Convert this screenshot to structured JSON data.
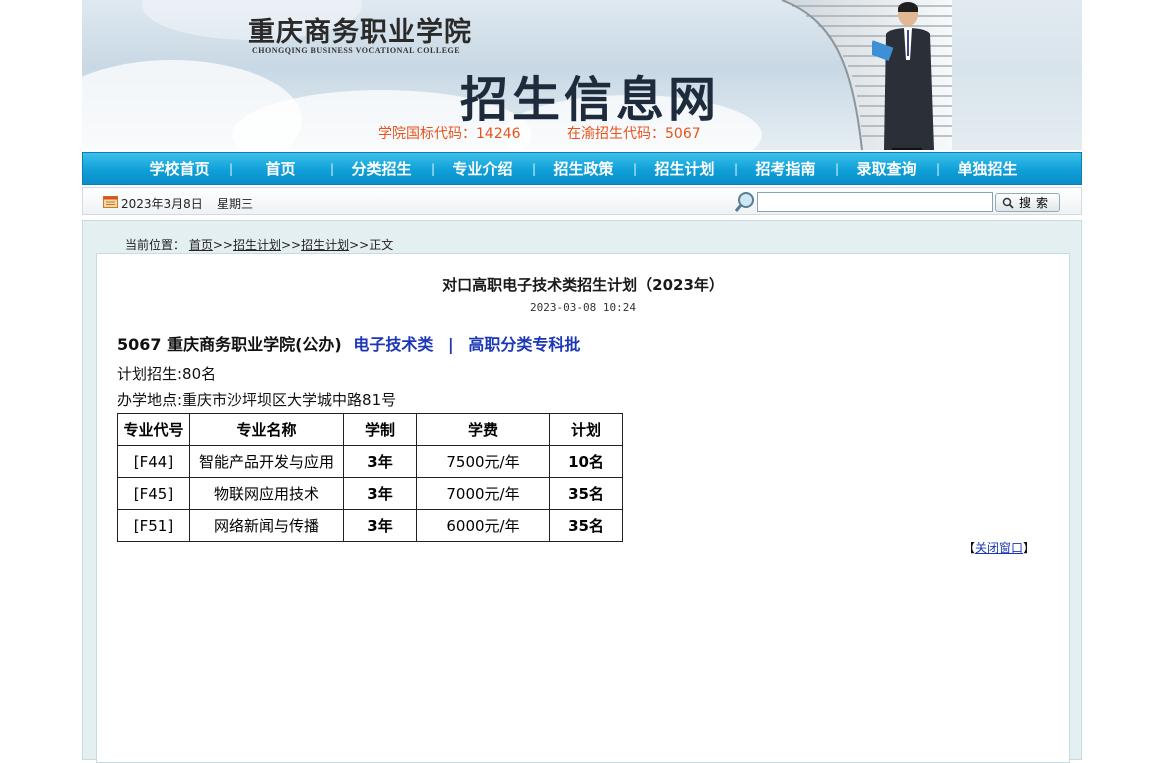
{
  "header": {
    "college_name_cn": "重庆商务职业学院",
    "college_name_en": "CHONGQING BUSINESS VOCATIONAL COLLEGE",
    "site_title": "招生信息网",
    "national_code": "学院国标代码：14246",
    "local_code": "在渝招生代码：5067",
    "code_color": "#e8531c"
  },
  "nav": {
    "items": [
      "学校首页",
      "首页",
      "分类招生",
      "专业介绍",
      "招生政策",
      "招生计划",
      "招考指南",
      "录取查询",
      "单独招生"
    ],
    "separator": "|",
    "bg_color": "#0f9fd8"
  },
  "toolbar": {
    "date": "2023年3月8日",
    "weekday": "星期三",
    "search_value": "",
    "search_button": "搜索"
  },
  "breadcrumb": {
    "label": "当前位置：",
    "links": [
      "首页",
      "招生计划",
      "招生计划"
    ],
    "sep": ">>",
    "current": "正文"
  },
  "article": {
    "title": "对口高职电子技术类招生计划（2023年）",
    "time": "2023-03-08 10:24",
    "school": "5067 重庆商务职业学院(公办)",
    "category": "电子技术类",
    "divider": "|",
    "batch": "高职分类专科批",
    "plan": "计划招生:80名",
    "address": "办学地点:重庆市沙坪坝区大学城中路81号",
    "table": {
      "headers": [
        "专业代号",
        "专业名称",
        "学制",
        "学费",
        "计划"
      ],
      "rows": [
        [
          "[F44]",
          "智能产品开发与应用",
          "3年",
          "7500元/年",
          "10名"
        ],
        [
          "[F45]",
          "物联网应用技术",
          "3年",
          "7000元/年",
          "35名"
        ],
        [
          "[F51]",
          "网络新闻与传播",
          "3年",
          "6000元/年",
          "35名"
        ]
      ]
    },
    "close_open": "【",
    "close_label": "关闭窗口",
    "close_close": "】"
  }
}
